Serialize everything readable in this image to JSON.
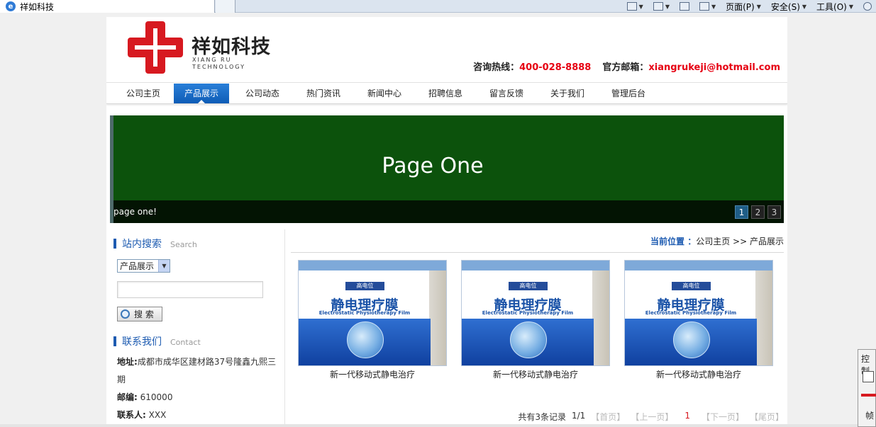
{
  "browser": {
    "tab_title": "祥如科技",
    "commands": [
      {
        "label": "页面(P)"
      },
      {
        "label": "安全(S)"
      },
      {
        "label": "工具(O)"
      }
    ]
  },
  "header": {
    "logo_cn": "祥如科技",
    "logo_en_line1": "XIANG RU",
    "logo_en_line2": "TECHNOLOGY",
    "hotline_label": "咨询热线：",
    "hotline": "400-028-8888",
    "email_label": "官方邮箱：",
    "email": "xiangrukeji@hotmail.com"
  },
  "nav": {
    "items": [
      {
        "label": "公司主页"
      },
      {
        "label": "产品展示"
      },
      {
        "label": "公司动态"
      },
      {
        "label": "热门资讯"
      },
      {
        "label": "新闻中心"
      },
      {
        "label": "招聘信息"
      },
      {
        "label": "留言反馈"
      },
      {
        "label": "关于我们"
      },
      {
        "label": "管理后台"
      }
    ],
    "active_index": 1
  },
  "banner": {
    "title": "Page One",
    "caption": "page one!",
    "pages": [
      "1",
      "2",
      "3"
    ],
    "active_page": "1",
    "bg_color": "#0c520c"
  },
  "sidebar": {
    "search": {
      "title": "站内搜索",
      "title_en": "Search",
      "category": "产品展示",
      "keyword": "",
      "button": "搜 索"
    },
    "contact": {
      "title": "联系我们",
      "title_en": "Contact",
      "address_label": "地址:",
      "address": "成都市成华区建材路37号隆鑫九熙三期",
      "zip_label": "邮编:",
      "zip": "610000",
      "person_label": "联系人:",
      "person": "XXX"
    }
  },
  "main": {
    "breadcrumb": {
      "label": "当前位置 ：",
      "home": "公司主页",
      "sep": ">>",
      "current": "产品展示"
    },
    "products": [
      {
        "name": "新一代移动式静电治疗",
        "box_title": "静电理疗膜",
        "box_en": "Electrostatic Physiotherapy Film",
        "brand": "高电位"
      },
      {
        "name": "新一代移动式静电治疗",
        "box_title": "静电理疗膜",
        "box_en": "Electrostatic Physiotherapy Film",
        "brand": "高电位"
      },
      {
        "name": "新一代移动式静电治疗",
        "box_title": "静电理疗膜",
        "box_en": "Electrostatic Physiotherapy Film",
        "brand": "高电位"
      }
    ],
    "pager": {
      "total": "共有3条记录",
      "page": "1/1",
      "first": "【首页】",
      "prev": "【上一页】",
      "current": "1",
      "next": "【下一页】",
      "last": "【尾页】"
    }
  },
  "float_panel": {
    "label": "控制",
    "label2": "帧"
  }
}
